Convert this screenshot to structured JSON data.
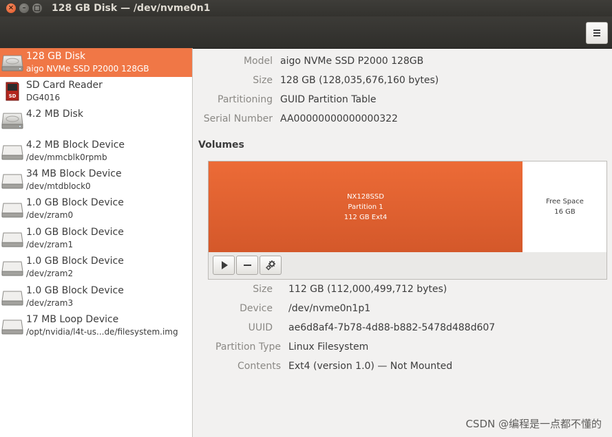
{
  "window": {
    "title": "128 GB Disk — /dev/nvme0n1"
  },
  "header": {
    "menu_icon": "hamburger-menu-icon"
  },
  "sidebar": {
    "devices": [
      {
        "name": "128 GB Disk",
        "sub": "aigo NVMe SSD P2000 128GB",
        "icon": "hard-disk-icon",
        "selected": true
      },
      {
        "name": "SD Card Reader",
        "sub": "DG4016",
        "icon": "sd-card-icon",
        "selected": false
      },
      {
        "name": "4.2 MB Disk",
        "sub": "",
        "icon": "hard-disk-icon",
        "selected": false
      },
      {
        "name": "4.2 MB Block Device",
        "sub": "/dev/mmcblk0rpmb",
        "icon": "block-device-icon",
        "selected": false
      },
      {
        "name": "34 MB Block Device",
        "sub": "/dev/mtdblock0",
        "icon": "block-device-icon",
        "selected": false
      },
      {
        "name": "1.0 GB Block Device",
        "sub": "/dev/zram0",
        "icon": "block-device-icon",
        "selected": false
      },
      {
        "name": "1.0 GB Block Device",
        "sub": "/dev/zram1",
        "icon": "block-device-icon",
        "selected": false
      },
      {
        "name": "1.0 GB Block Device",
        "sub": "/dev/zram2",
        "icon": "block-device-icon",
        "selected": false
      },
      {
        "name": "1.0 GB Block Device",
        "sub": "/dev/zram3",
        "icon": "block-device-icon",
        "selected": false
      },
      {
        "name": "17 MB Loop Device",
        "sub": "/opt/nvidia/l4t-us...de/filesystem.img",
        "icon": "block-device-icon",
        "selected": false
      }
    ]
  },
  "disk": {
    "model_label": "Model",
    "model": "aigo NVMe SSD P2000 128GB",
    "size_label": "Size",
    "size": "128 GB (128,035,676,160 bytes)",
    "partitioning_label": "Partitioning",
    "partitioning": "GUID Partition Table",
    "serial_label": "Serial Number",
    "serial": "AA00000000000000322"
  },
  "volumes": {
    "heading": "Volumes",
    "partition": {
      "line1": "NX128SSD",
      "line2": "Partition 1",
      "line3": "112 GB Ext4",
      "color": "#e4622f"
    },
    "free": {
      "line1": "Free Space",
      "line2": "16 GB"
    },
    "toolbar": {
      "mount_icon": "play-icon",
      "delete_icon": "minus-icon",
      "settings_icon": "gears-icon"
    }
  },
  "partition_info": {
    "size_label": "Size",
    "size": "112 GB (112,000,499,712 bytes)",
    "device_label": "Device",
    "device": "/dev/nvme0n1p1",
    "uuid_label": "UUID",
    "uuid": "ae6d8af4-7b78-4d88-b882-5478d488d607",
    "type_label": "Partition Type",
    "type": "Linux Filesystem",
    "contents_label": "Contents",
    "contents": "Ext4 (version 1.0) — Not Mounted"
  },
  "watermark": "CSDN @编程是一点都不懂的"
}
